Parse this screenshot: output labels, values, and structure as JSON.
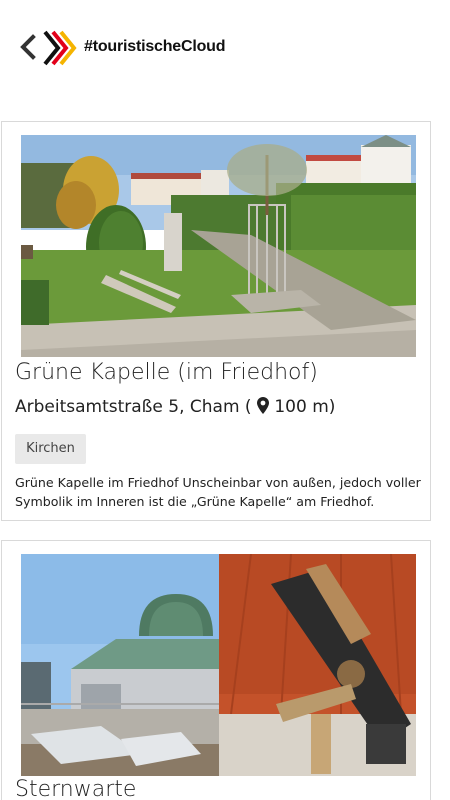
{
  "header": {
    "brand": "#touristischeCloud",
    "back_icon": "chevron-left-icon",
    "logo_icon": "chevron-stripes-logo"
  },
  "cards": [
    {
      "title": "Grüne Kapelle (im Friedhof)",
      "address": "Arbeitsamtstraße 5, Cham (",
      "distance": "100 m)",
      "category": "Kirchen",
      "description": "Grüne Kapelle im Friedhof   Unscheinbar von außen, jedoch voller Symbolik im Inneren ist die „Grüne Kapelle“ am Friedhof."
    },
    {
      "title": "Sternwarte"
    }
  ],
  "colors": {
    "logo_black": "#111111",
    "logo_red": "#e2001a",
    "logo_yellow": "#f5b400",
    "tag_bg": "#e9e9e9",
    "card_border": "#d9d9d9"
  }
}
